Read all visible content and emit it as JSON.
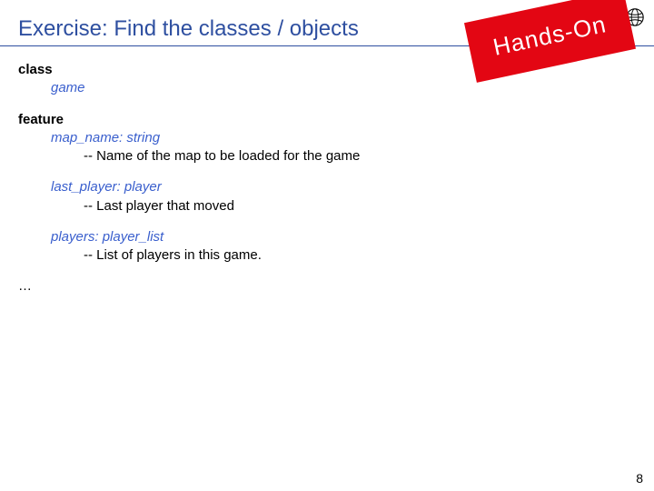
{
  "title": "Exercise: Find the classes / objects",
  "badge": "Hands-On",
  "page_number": "8",
  "code": {
    "kw_class": "class",
    "class_name": "game",
    "kw_feature": "feature",
    "attr1_decl": "map_name: string",
    "attr1_comment": "-- Name of the map to be loaded for the game",
    "attr2_decl": "last_player: player",
    "attr2_comment": "-- Last player that moved",
    "attr3_decl": "players: player_list",
    "attr3_comment": "-- List of players in this game.",
    "ellipsis": "…"
  }
}
